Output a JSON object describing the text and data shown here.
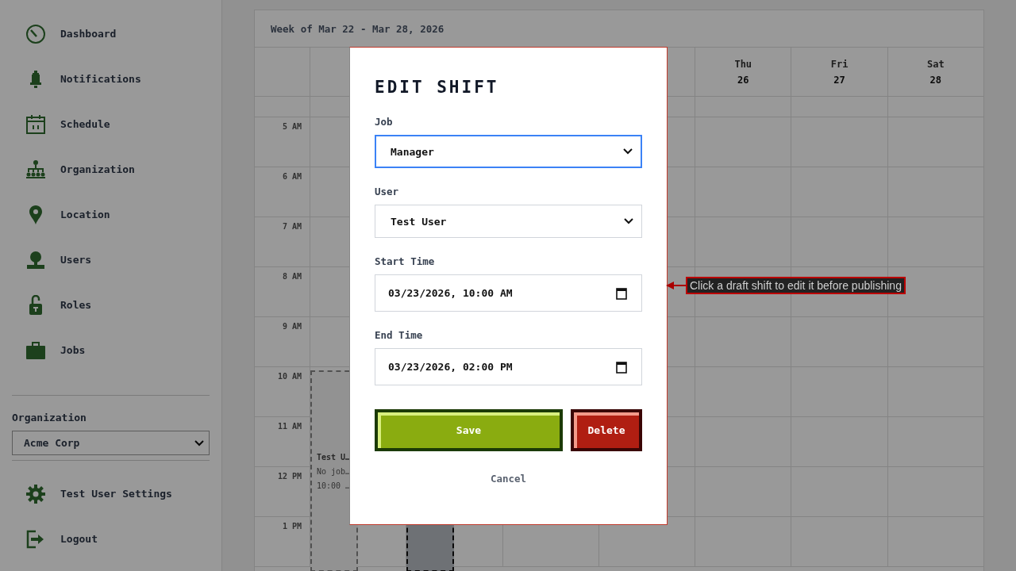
{
  "sidebar": {
    "nav_items": [
      {
        "label": "Dashboard"
      },
      {
        "label": "Notifications"
      },
      {
        "label": "Schedule"
      },
      {
        "label": "Organization"
      },
      {
        "label": "Location"
      },
      {
        "label": "Users"
      },
      {
        "label": "Roles"
      },
      {
        "label": "Jobs"
      }
    ],
    "organization_label": "Organization",
    "organization_select": {
      "value": "Acme Corp"
    },
    "footer_items": [
      {
        "label": "Test User Settings"
      },
      {
        "label": "Logout"
      }
    ]
  },
  "calendar": {
    "title": "Week of Mar 22 - Mar 28, 2026",
    "columns": [
      {
        "shifts": [
          {
            "kind": "draft",
            "lines": [
              "Test U…",
              "No job…",
              "10:00 …"
            ]
          }
        ]
      },
      {
        "shifts": [
          {
            "kind": "selected"
          }
        ]
      },
      {},
      {},
      {
        "day": "Thu",
        "date": "26"
      },
      {
        "day": "Fri",
        "date": "27"
      },
      {
        "day": "Sat",
        "date": "28"
      }
    ],
    "hours": [
      "5 AM",
      "6 AM",
      "7 AM",
      "8 AM",
      "9 AM",
      "10 AM",
      "11 AM",
      "12 PM",
      "1 PM"
    ]
  },
  "dialog": {
    "title": "EDIT SHIFT",
    "fields": [
      {
        "kind": "select",
        "label": "Job",
        "value": "Manager",
        "focused": true
      },
      {
        "kind": "select",
        "label": "User",
        "value": "Test User",
        "focused": false
      },
      {
        "kind": "datetime",
        "label": "Start Time",
        "value": "03/23/2026, 10:00 AM",
        "focused": false
      },
      {
        "kind": "datetime",
        "label": "End Time",
        "value": "03/23/2026, 02:00 PM",
        "focused": false
      }
    ],
    "buttons": [
      {
        "kind": "primary",
        "label": "Save"
      },
      {
        "kind": "danger",
        "label": "Delete"
      }
    ],
    "cancel": "Cancel"
  },
  "tooltip": {
    "text": "Click a draft shift to edit it before publishing"
  }
}
